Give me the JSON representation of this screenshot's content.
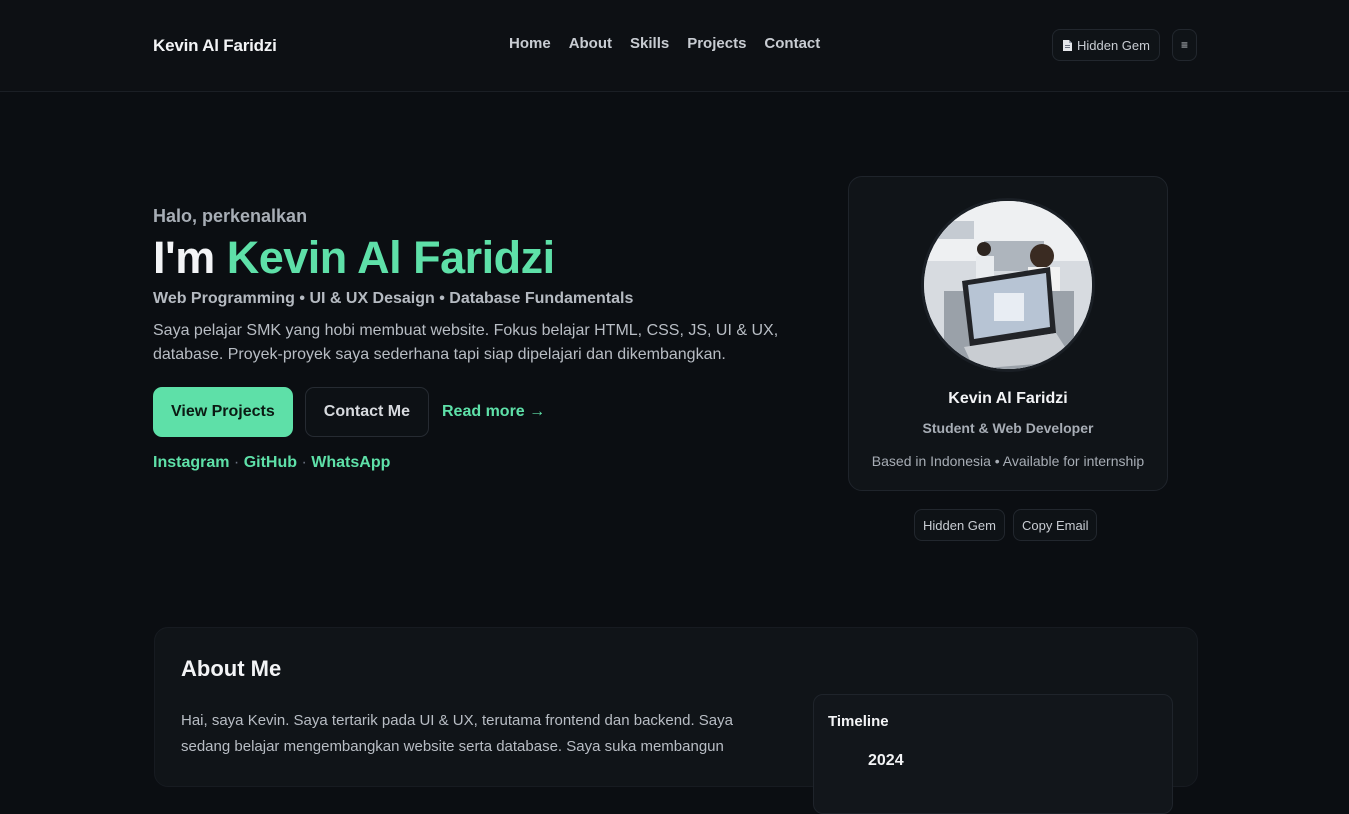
{
  "header": {
    "brand": "Kevin Al Faridzi",
    "nav": [
      "Home",
      "About",
      "Skills",
      "Projects",
      "Contact"
    ],
    "hidden_gem_button": "Hidden Gem",
    "menu_icon": "≡"
  },
  "hero": {
    "greeting": "Halo, perkenalkan",
    "title_prefix": "I'm",
    "title_name": "Kevin Al Faridzi",
    "roles": "Web Programming • UI & UX Desaign • Database Fundamentals",
    "description": "Saya pelajar SMK yang hobi membuat website. Fokus belajar HTML, CSS, JS, UI & UX, database. Proyek-proyek saya sederhana tapi siap dipelajari dan dikembangkan.",
    "buttons": {
      "view_projects": "View Projects",
      "contact_me": "Contact Me",
      "read_more": "Read more →"
    },
    "socials": [
      "Instagram",
      "GitHub",
      "WhatsApp"
    ],
    "social_separator": "·"
  },
  "profile_card": {
    "name": "Kevin Al Faridzi",
    "role": "Student & Web Developer",
    "location": "Based in Indonesia • Available for internship"
  },
  "chips": {
    "hidden_gem": "Hidden Gem",
    "copy_email": "Copy Email"
  },
  "about": {
    "title": "About Me",
    "text": "Hai, saya Kevin. Saya tertarik pada UI & UX, terutama frontend dan backend. Saya sedang belajar mengembangkan website serta database. Saya suka membangun",
    "timeline": {
      "title": "Timeline",
      "year": "2024"
    }
  },
  "colors": {
    "accent": "#5ee0a8",
    "background": "#0b0e12",
    "card": "#101418"
  }
}
